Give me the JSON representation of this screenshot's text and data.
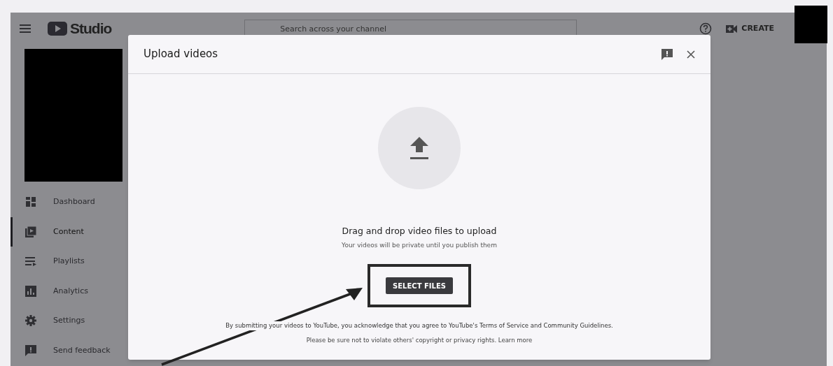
{
  "topbar": {
    "logo_text": "Studio",
    "search": {
      "placeholder": "Search across your channel"
    },
    "create": "CREATE"
  },
  "sidebar": {
    "items": [
      {
        "label": "Dashboard",
        "kind": "dashboard",
        "selected": false
      },
      {
        "label": "Content",
        "kind": "content",
        "selected": true
      },
      {
        "label": "Playlists",
        "kind": "playlists",
        "selected": false
      },
      {
        "label": "Analytics",
        "kind": "analytics",
        "selected": false
      },
      {
        "label": "Settings",
        "kind": "settings",
        "selected": false
      },
      {
        "label": "Send feedback",
        "kind": "feedback",
        "selected": false
      }
    ]
  },
  "dialog": {
    "title": "Upload videos",
    "heading": "Drag and drop video files to upload",
    "subtext": "Your videos will be private until you publish them",
    "button": "SELECT FILES",
    "terms": "By submitting your videos to YouTube, you acknowledge that you agree to YouTube's Terms of Service and Community Guidelines.",
    "notice": "Please be sure not to violate others' copyright or privacy rights.",
    "link": "Learn more"
  }
}
